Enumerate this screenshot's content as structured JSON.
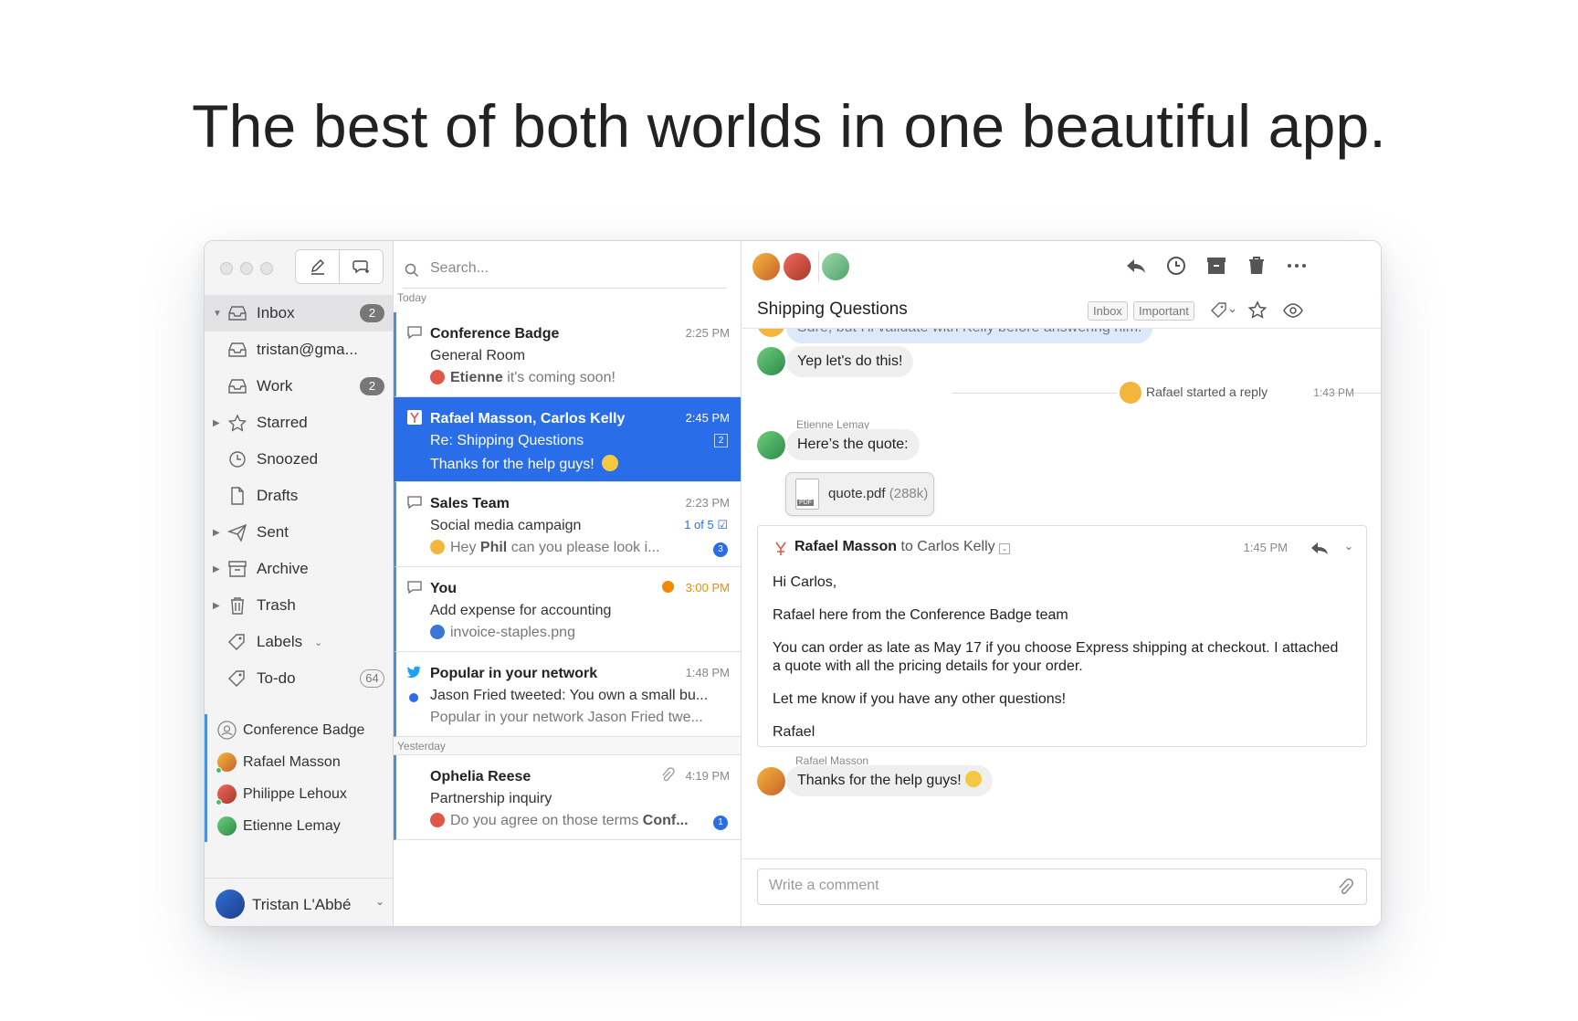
{
  "headline": "The best of both worlds in one beautiful app.",
  "colors": {
    "accent": "#2a6de8",
    "shared_bar": "#4a90e2",
    "presence": "#37c76b",
    "snooze_orange": "#f08a00"
  },
  "sidebar": {
    "icons": [
      "compose-icon",
      "new-chat-icon"
    ],
    "items": [
      {
        "label": "Inbox",
        "badge": "2",
        "icon": "inbox-icon"
      },
      {
        "label": "tristan@gma...",
        "icon": "inbox-icon"
      },
      {
        "label": "Work",
        "badge": "2",
        "icon": "inbox-icon"
      },
      {
        "label": "Starred",
        "icon": "star-icon"
      },
      {
        "label": "Snoozed",
        "icon": "clock-icon"
      },
      {
        "label": "Drafts",
        "icon": "document-icon"
      },
      {
        "label": "Sent",
        "icon": "paper-plane-icon"
      },
      {
        "label": "Archive",
        "icon": "archive-icon"
      },
      {
        "label": "Trash",
        "icon": "trash-icon"
      },
      {
        "label": "Labels",
        "icon": "tag-icon"
      },
      {
        "label": "To-do",
        "badge": "64",
        "icon": "tag-icon"
      }
    ],
    "shared": [
      {
        "label": "Conference Badge"
      },
      {
        "label": "Rafael Masson"
      },
      {
        "label": "Philippe Lehoux"
      },
      {
        "label": "Etienne Lemay"
      }
    ],
    "account": {
      "name": "Tristan L'Abbé"
    }
  },
  "list": {
    "search_placeholder": "Search...",
    "today_label": "Today",
    "yesterday_label": "Yesterday",
    "messages": [
      {
        "sender": "Conference Badge",
        "time": "2:25 PM",
        "subject": "General Room",
        "preview_name": "Etienne",
        "preview_text": "it's coming soon!"
      },
      {
        "sender": "Rafael Masson, Carlos Kelly",
        "time": "2:45 PM",
        "subject": "Re: Shipping Questions",
        "preview_text": "Thanks for the help guys!",
        "count": "2"
      },
      {
        "sender": "Sales Team",
        "time": "2:23 PM",
        "subject": "Social media campaign",
        "of": "1 of 5",
        "preview_pre": "Hey",
        "preview_name": "Phil",
        "preview_text": "can you please look i...",
        "unread": "3"
      },
      {
        "sender": "You",
        "time": "3:00 PM",
        "subject": "Add expense for accounting",
        "preview_text": "invoice-staples.png"
      },
      {
        "sender": "Popular in your network",
        "time": "1:48 PM",
        "subject": "Jason Fried tweeted: You own a small bu...",
        "preview_text": "Popular in your network Jason Fried twe..."
      },
      {
        "sender": "Ophelia Reese",
        "time": "4:19 PM",
        "subject": "Partnership inquiry",
        "preview_text": "Do you agree on those terms",
        "preview_bold": "Conf...",
        "unread": "1"
      }
    ]
  },
  "conversation": {
    "title": "Shipping Questions",
    "tags": [
      "Inbox",
      "Important"
    ],
    "toolbar_icons": [
      "reply-icon",
      "snooze-icon",
      "archive-icon",
      "trash-icon",
      "more-icon"
    ],
    "cut_bubble": "Sure, but I'll validate with Kelly before answering him.",
    "bubble1": "Yep let's do this!",
    "system": {
      "text": "Rafael started a reply",
      "time": "1:43 PM"
    },
    "etienne_name": "Etienne Lemay",
    "bubble2": "Here’s the quote:",
    "attachment": {
      "name": "quote.pdf",
      "size": "(288k)",
      "badge": "PDF"
    },
    "email": {
      "from": "Rafael Masson",
      "to_word": "to",
      "to": "Carlos Kelly",
      "time": "1:45 PM",
      "greeting": "Hi Carlos,",
      "p1": "Rafael here from the Conference Badge team",
      "p2": "You can order as late as May 17 if you choose Express shipping at checkout. I attached a quote with all the pricing details for your order.",
      "p3": "Let me know if you have any other questions!",
      "sign": "Rafael"
    },
    "rafael_name": "Rafael Masson",
    "bubble3": "Thanks for the help guys!",
    "comment_placeholder": "Write a comment"
  }
}
